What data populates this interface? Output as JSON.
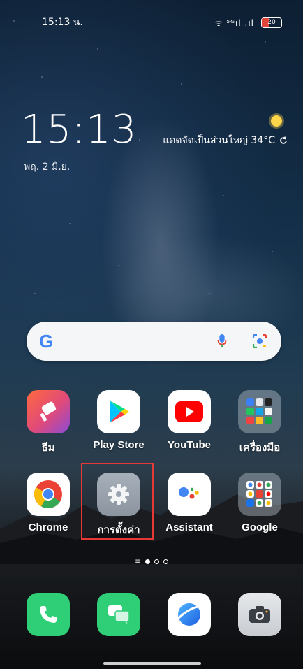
{
  "statusbar": {
    "time": "15:13 น.",
    "signal_text": "ᯤ ⁵ᴳıl .ıl",
    "battery": "20"
  },
  "lockclock": {
    "time": "15:13",
    "date": "พฤ. 2 มิ.ย."
  },
  "weather": {
    "text": "แดดจัดเป็นส่วนใหญ่ 34°C",
    "refresh_icon": "refresh-icon",
    "condition_icon": "sun-icon"
  },
  "search": {
    "logo": "G",
    "mic_icon": "mic-icon",
    "lens_icon": "camera-lens-icon"
  },
  "apps": [
    {
      "label": "ธีม",
      "icon": "theme-icon",
      "color": "#e04a7a"
    },
    {
      "label": "Play Store",
      "icon": "play-store-icon",
      "color": "#ffffff"
    },
    {
      "label": "YouTube",
      "icon": "youtube-icon",
      "color": "#ff0000"
    },
    {
      "label": "เครื่องมือ",
      "icon": "tools-folder-icon",
      "color": "#7a8896"
    },
    {
      "label": "Chrome",
      "icon": "chrome-icon",
      "color": "#ffffff"
    },
    {
      "label": "การตั้งค่า",
      "icon": "settings-gear-icon",
      "color": "#9aa3ad"
    },
    {
      "label": "Assistant",
      "icon": "assistant-icon",
      "color": "#ffffff"
    },
    {
      "label": "Google",
      "icon": "google-folder-icon",
      "color": "#7a8896"
    }
  ],
  "dock": [
    {
      "icon": "phone-icon",
      "color": "#2fcf78"
    },
    {
      "icon": "messages-icon",
      "color": "#2fcf78"
    },
    {
      "icon": "browser-icon",
      "color": "#ffffff"
    },
    {
      "icon": "camera-icon",
      "color": "#d6d9de"
    }
  ],
  "page_indicator": {
    "pages": 3,
    "active": 1
  }
}
